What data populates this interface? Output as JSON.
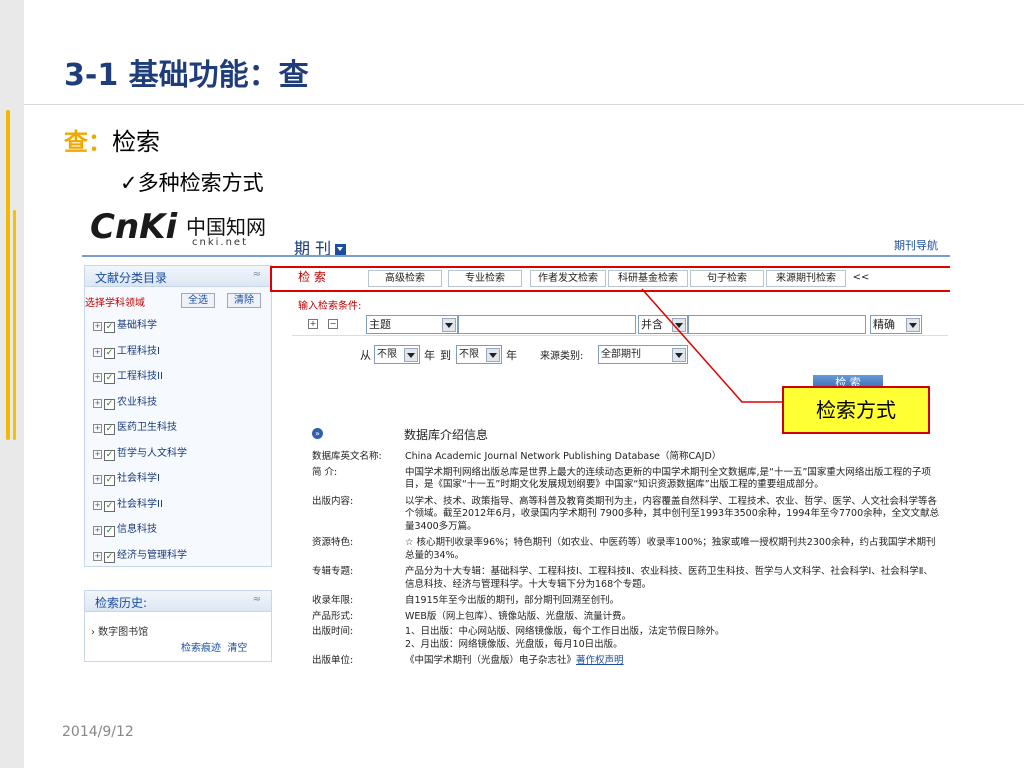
{
  "slide": {
    "title": "3-1 基础功能：查",
    "subtitle_highlight": "查：",
    "subtitle_text": "检索",
    "bullet": "✓多种检索方式",
    "date": "2014/9/12"
  },
  "cnki": {
    "logo_mark": "CnKi",
    "logo_cn": "中国知网",
    "logo_domain": "cnki.net",
    "journal_title": "期 刊",
    "journal_nav": "期刊导航"
  },
  "sidebar": {
    "heading": "文献分类目录",
    "collapse_symbol": "≈",
    "select_label": "选择学科领域",
    "select_all": "全选",
    "clear": "清除",
    "categories": [
      "基础科学",
      "工程科技I",
      "工程科技II",
      "农业科技",
      "医药卫生科技",
      "哲学与人文科学",
      "社会科学I",
      "社会科学II",
      "信息科技",
      "经济与管理科学"
    ]
  },
  "history": {
    "heading": "检索历史:",
    "item": "› 数字图书馆",
    "trace": "检索痕迹",
    "clear": "清空"
  },
  "tabs": {
    "items": [
      "检 索",
      "高级检索",
      "专业检索",
      "作者发文检索",
      "科研基金检索",
      "句子检索",
      "来源期刊检索"
    ],
    "more": "<<"
  },
  "form": {
    "condition_label": "输入检索条件:",
    "field_value": "主题",
    "combine_value": "并含",
    "match_value": "精确",
    "from": "从",
    "year_from": "不限",
    "year_word": "年",
    "to": "到",
    "year_to": "不限",
    "source_label": "来源类别:",
    "source_value": "全部期刊",
    "search_button": "检 索"
  },
  "callout": {
    "label": "检索方式"
  },
  "info": {
    "heading": "数据库介绍信息",
    "rows": [
      {
        "k": "数据库英文名称:",
        "v": "China Academic Journal Network Publishing Database（简称CAJD）"
      },
      {
        "k": "简    介:",
        "v": "中国学术期刊网络出版总库是世界上最大的连续动态更新的中国学术期刊全文数据库,是“十一五”国家重大网络出版工程的子项目，是《国家“十一五”时期文化发展规划纲要》中国家“知识资源数据库”出版工程的重要组成部分。"
      },
      {
        "k": "出版内容:",
        "v": "以学术、技术、政策指导、高等科普及教育类期刊为主，内容覆盖自然科学、工程技术、农业、哲学、医学、人文社会科学等各个领域。截至2012年6月，收录国内学术期刊 7900多种，其中创刊至1993年3500余种，1994年至今7700余种，全文文献总量3400多万篇。"
      },
      {
        "k": "资源特色:",
        "v": "☆ 核心期刊收录率96%；特色期刊（如农业、中医药等）收录率100%；独家或唯一授权期刊共2300余种，约占我国学术期刊总量的34%。"
      },
      {
        "k": "专辑专题:",
        "v": "产品分为十大专辑：基础科学、工程科技Ⅰ、工程科技Ⅱ、农业科技、医药卫生科技、哲学与人文科学、社会科学Ⅰ、社会科学Ⅱ、信息科技、经济与管理科学。十大专辑下分为168个专题。"
      },
      {
        "k": "收录年限:",
        "v": "自1915年至今出版的期刊，部分期刊回溯至创刊。"
      },
      {
        "k": "产品形式:",
        "v": "WEB版（网上包库）、镜像站版、光盘版、流量计费。"
      },
      {
        "k": "出版时间:",
        "v": "1、日出版：中心网站版、网络镜像版，每个工作日出版，法定节假日除外。\n2、月出版：网络镜像版、光盘版，每月10日出版。"
      },
      {
        "k": "出版单位:",
        "v": "《中国学术期刊（光盘版）电子杂志社》"
      }
    ],
    "copyright_link": "著作权声明"
  },
  "colors": {
    "title_blue": "#1f3d7a",
    "highlight_orange": "#f0a800",
    "callout_yellow": "#ffff33",
    "callout_red": "#d00000"
  }
}
